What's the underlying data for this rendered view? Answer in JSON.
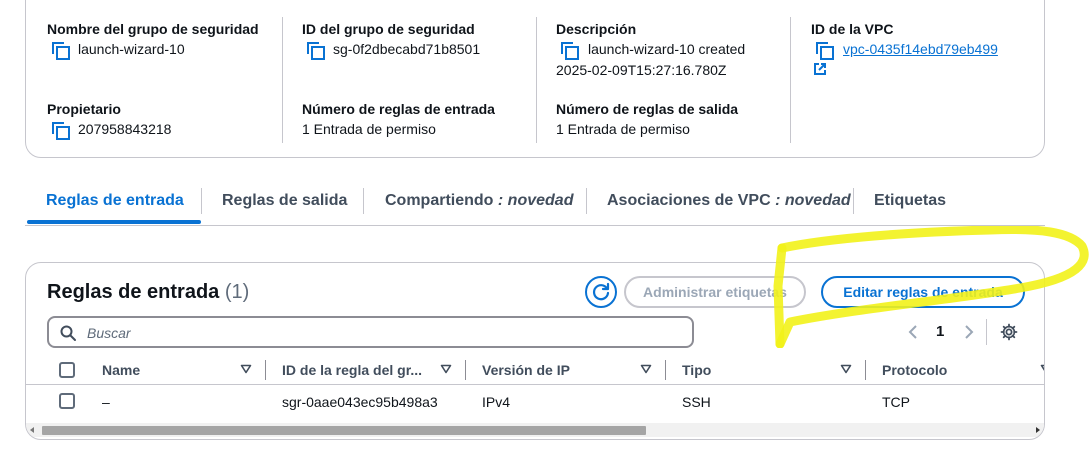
{
  "details": {
    "col1": {
      "label1": "Nombre del grupo de seguridad",
      "value1": "launch-wizard-10",
      "label2": "Propietario",
      "value2": "207958843218"
    },
    "col2": {
      "label1": "ID del grupo de seguridad",
      "value1": "sg-0f2dbecabd71b8501",
      "label2": "Número de reglas de entrada",
      "value2": "1 Entrada de permiso"
    },
    "col3": {
      "label1": "Descripción",
      "value1_line1": "launch-wizard-10 created",
      "value1_line2": "2025-02-09T15:27:16.780Z",
      "label2": "Número de reglas de salida",
      "value2": "1 Entrada de permiso"
    },
    "col4": {
      "label1": "ID de la VPC",
      "value1": "vpc-0435f14ebd79eb499"
    }
  },
  "tabs": [
    {
      "label": "Reglas de entrada",
      "suffix": ""
    },
    {
      "label": "Reglas de salida",
      "suffix": ""
    },
    {
      "label": "Compartiendo",
      "suffix": ": novedad"
    },
    {
      "label": "Asociaciones de VPC",
      "suffix": ": novedad"
    },
    {
      "label": "Etiquetas",
      "suffix": ""
    }
  ],
  "inbound": {
    "title": "Reglas de entrada",
    "count": "(1)",
    "manage_tags_label": "Administrar etiquetas",
    "edit_rules_label": "Editar reglas de entrada",
    "search_placeholder": "Buscar",
    "page": "1",
    "columns": [
      "Name",
      "ID de la regla del gr...",
      "Versión de IP",
      "Tipo",
      "Protocolo"
    ],
    "rows": [
      {
        "name": "–",
        "rule_id": "sgr-0aae043ec95b498a3",
        "ip_version": "IPv4",
        "type": "SSH",
        "protocol": "TCP"
      }
    ]
  },
  "colors": {
    "accent": "#0972d3",
    "highlight": "#f2f21a"
  },
  "icons": [
    "copy-icon",
    "external-link-icon",
    "refresh-icon",
    "search-icon",
    "chevron-left-icon",
    "chevron-right-icon",
    "settings-icon",
    "sort-icon"
  ]
}
